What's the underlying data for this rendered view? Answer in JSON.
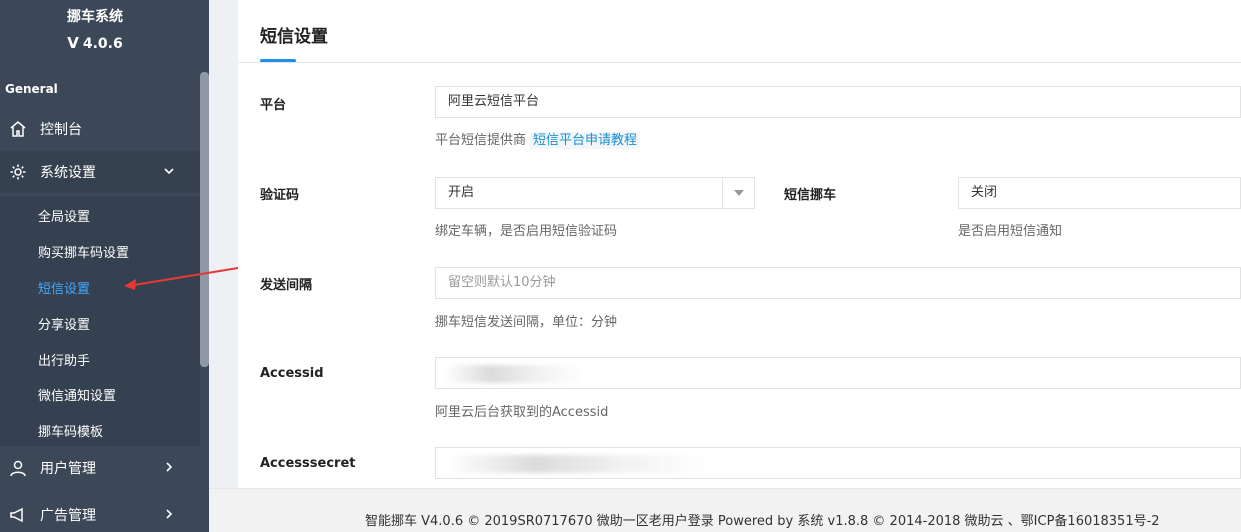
{
  "sidebar": {
    "brand": "挪车系统",
    "version_mark": "V",
    "version": "4.0.6",
    "section_label": "General",
    "items": [
      {
        "label": "控制台",
        "icon": "home-icon"
      },
      {
        "label": "系统设置",
        "icon": "gear-icon",
        "expanded": true
      },
      {
        "label": "用户管理",
        "icon": "user-icon"
      },
      {
        "label": "广告管理",
        "icon": "megaphone-icon"
      }
    ],
    "submenu": [
      {
        "label": "全局设置"
      },
      {
        "label": "购买挪车码设置"
      },
      {
        "label": "短信设置",
        "active": true
      },
      {
        "label": "分享设置"
      },
      {
        "label": "出行助手"
      },
      {
        "label": "微信通知设置"
      },
      {
        "label": "挪车码模板"
      }
    ]
  },
  "main": {
    "title": "短信设置",
    "fields": {
      "platform": {
        "label": "平台",
        "value": "阿里云短信平台",
        "help": "平台短信提供商",
        "help_link": "短信平台申请教程"
      },
      "captcha": {
        "label": "验证码",
        "value": "开启",
        "help": "绑定车辆，是否启用短信验证码"
      },
      "sms_move": {
        "label": "短信挪车",
        "value": "关闭",
        "help": "是否启用短信通知"
      },
      "interval": {
        "label": "发送间隔",
        "placeholder": "留空则默认10分钟",
        "help": "挪车短信发送间隔，单位：分钟"
      },
      "accessid": {
        "label": "Accessid",
        "help": "阿里云后台获取到的Accessid"
      },
      "accesssecret": {
        "label": "Accesssecret"
      }
    }
  },
  "footer": {
    "text": "智能挪车 V4.0.6 © 2019SR0717670 微助一区老用户登录 Powered by 系统 v1.8.8 © 2014-2018 微助云 、鄂ICP备16018351号-2"
  },
  "colors": {
    "sidebar_bg": "#3c4858",
    "active_link": "#40a9ff",
    "accent": "#1e90e6",
    "arrow": "#e53935"
  }
}
